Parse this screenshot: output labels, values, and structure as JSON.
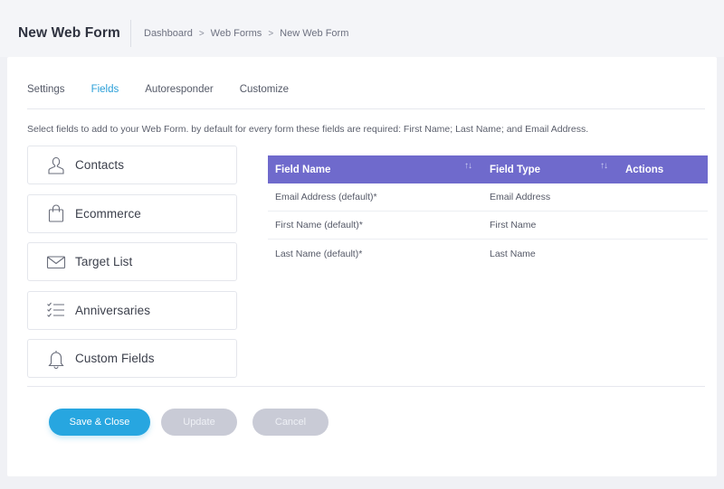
{
  "header": {
    "title": "New Web Form",
    "breadcrumb": [
      "Dashboard",
      "Web Forms",
      "New Web Form"
    ],
    "breadcrumb_separator": ">"
  },
  "tabs": [
    {
      "label": "Settings",
      "active": false
    },
    {
      "label": "Fields",
      "active": true
    },
    {
      "label": "Autoresponder",
      "active": false
    },
    {
      "label": "Customize",
      "active": false
    }
  ],
  "hint": "Select fields to add to your Web Form. by default for every form these fields are required: First Name; Last Name; and Email Address.",
  "categories": [
    {
      "label": "Contacts",
      "icon": "person-icon"
    },
    {
      "label": "Ecommerce",
      "icon": "shopping-bag-icon"
    },
    {
      "label": "Target List",
      "icon": "envelope-icon"
    },
    {
      "label": "Anniversaries",
      "icon": "checklist-icon"
    },
    {
      "label": "Custom Fields",
      "icon": "bell-icon"
    }
  ],
  "table": {
    "columns": [
      "Field Name",
      "Field Type",
      "Actions"
    ],
    "sort_glyph": "↑↓",
    "rows": [
      [
        "Email Address (default)*",
        "Email Address",
        ""
      ],
      [
        "First Name (default)*",
        "First Name",
        ""
      ],
      [
        "Last Name (default)*",
        "Last Name",
        ""
      ]
    ]
  },
  "buttons": {
    "save": "Save & Close",
    "update": "Update",
    "cancel": "Cancel"
  },
  "colors": {
    "accent": "#27a6e0",
    "table_header": "#6f6acc",
    "disabled_button": "#c9cbd6"
  }
}
